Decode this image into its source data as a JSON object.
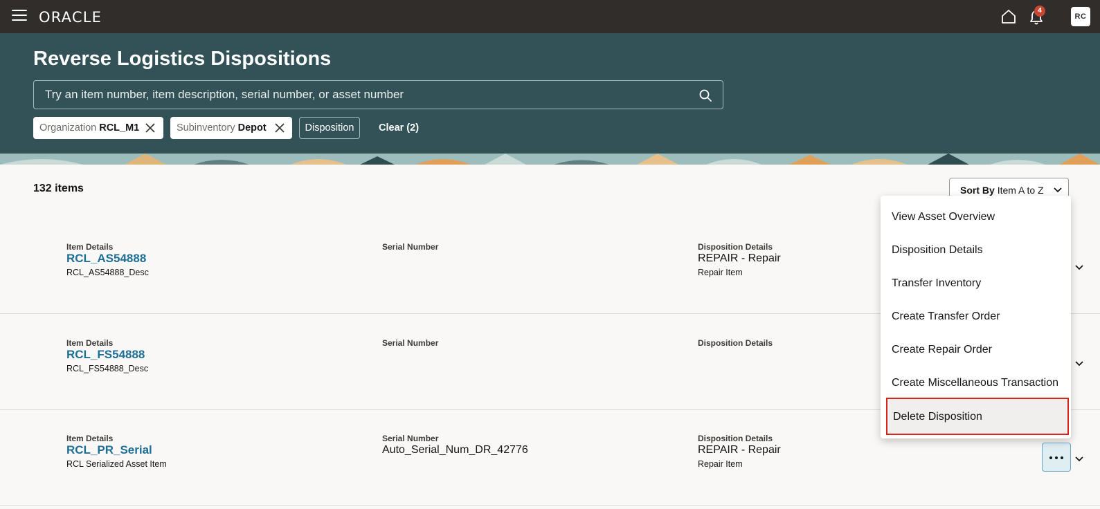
{
  "topbar": {
    "logo": "ORACLE",
    "notification_count": "4",
    "avatar_initials": "RC"
  },
  "header": {
    "title": "Reverse Logistics Dispositions",
    "search_placeholder": "Try an item number, item description, serial number, or asset number",
    "filters": [
      {
        "label": "Organization",
        "value": "RCL_M1"
      },
      {
        "label": "Subinventory",
        "value": "Depot"
      }
    ],
    "disposition_filter": "Disposition",
    "clear_label": "Clear (2)"
  },
  "list": {
    "count": "132 items",
    "sort_label": "Sort By",
    "sort_value": "Item A to Z",
    "col_item": "Item Details",
    "col_serial": "Serial Number",
    "col_disp": "Disposition Details",
    "rows": [
      {
        "item": "RCL_AS54888",
        "desc": "RCL_AS54888_Desc",
        "serial": "",
        "disposition": "REPAIR - Repair",
        "disposition_sub": "Repair Item"
      },
      {
        "item": "RCL_FS54888",
        "desc": "RCL_FS54888_Desc",
        "serial": "",
        "disposition": "",
        "disposition_sub": ""
      },
      {
        "item": "RCL_PR_Serial",
        "desc": "RCL Serialized Asset Item",
        "serial": "Auto_Serial_Num_DR_42776",
        "disposition": "REPAIR - Repair",
        "disposition_sub": "Repair Item"
      }
    ]
  },
  "actions_menu": {
    "items": [
      "View Asset Overview",
      "Disposition Details",
      "Transfer Inventory",
      "Create Transfer Order",
      "Create Repair Order",
      "Create Miscellaneous Transaction",
      "Delete Disposition"
    ],
    "highlighted_index": 6
  },
  "colors": {
    "topbar": "#312d2a",
    "header": "#325258",
    "link": "#1e6f96",
    "highlight_border": "#d9241b",
    "badge": "#c74634"
  }
}
